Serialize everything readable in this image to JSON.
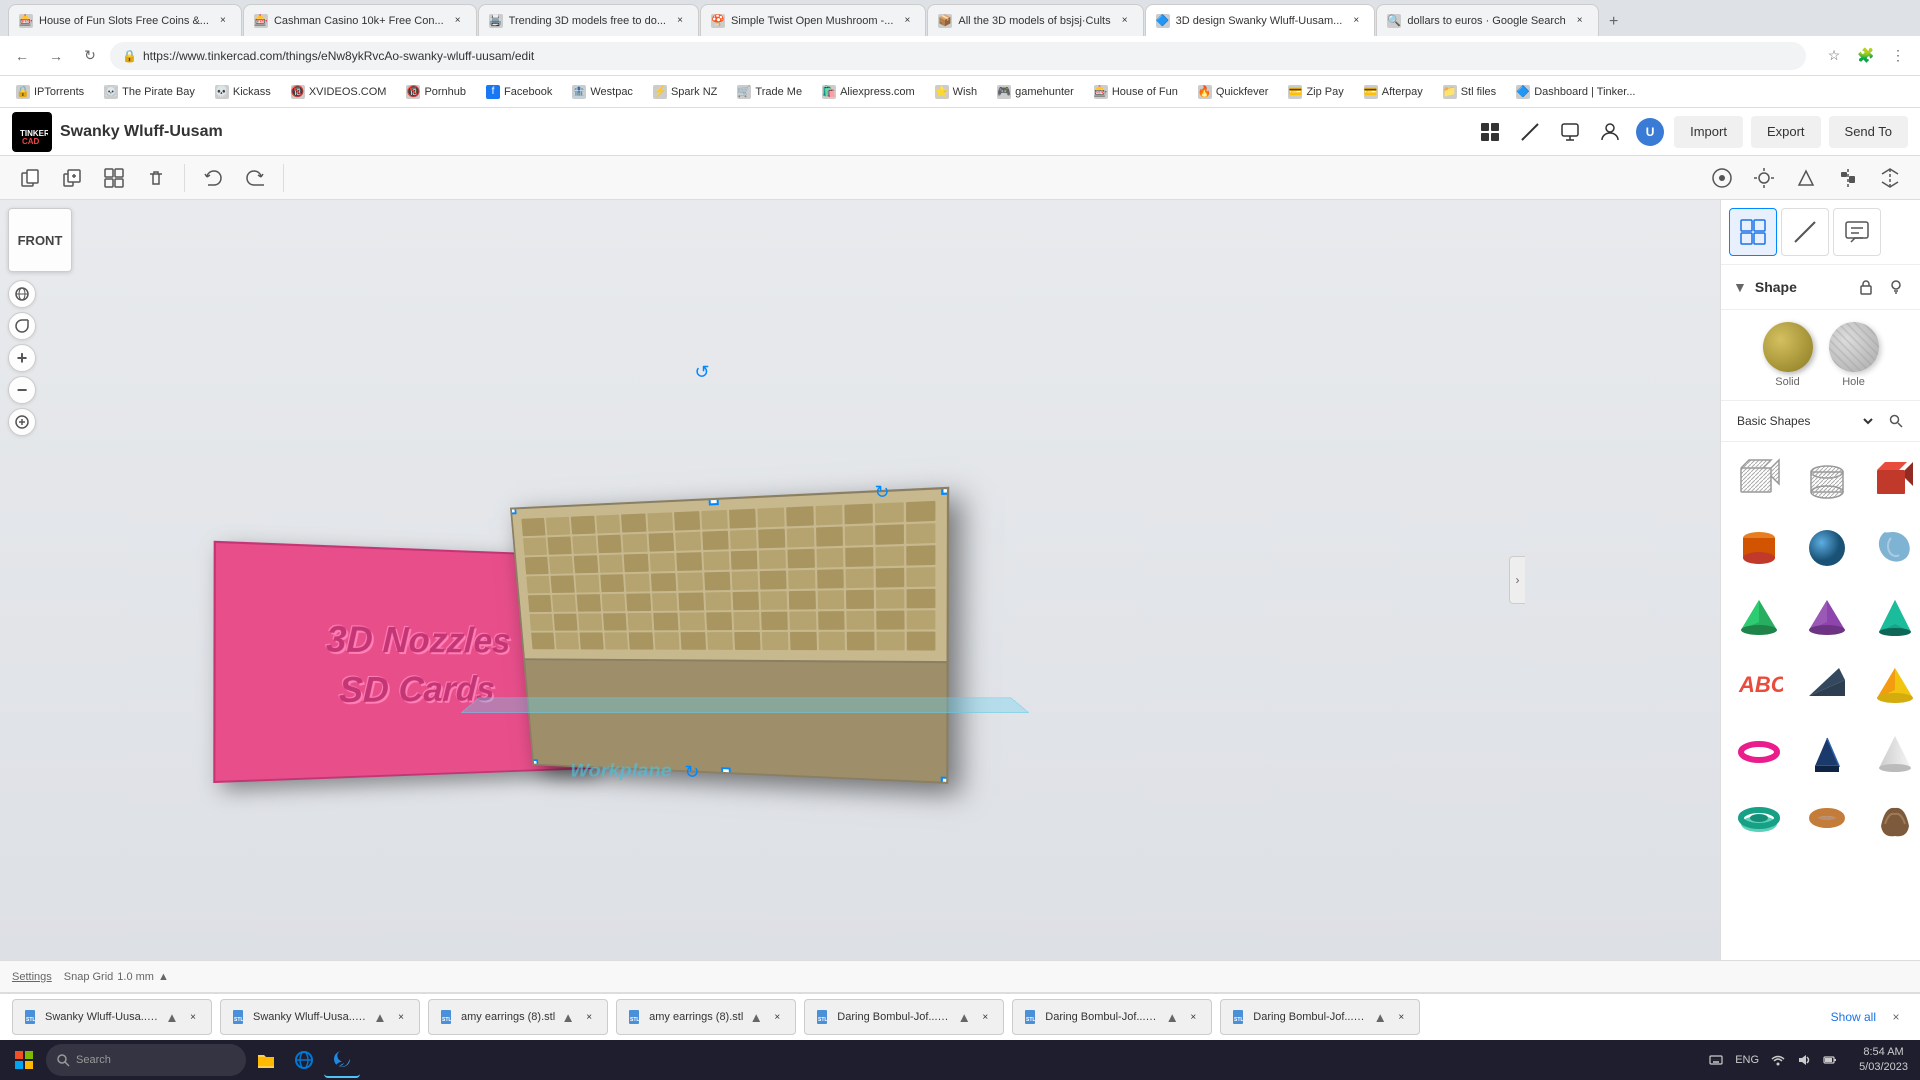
{
  "browser": {
    "tabs": [
      {
        "id": "tab1",
        "title": "House of Fun Slots Free Coins &...",
        "favicon": "🎰",
        "active": false
      },
      {
        "id": "tab2",
        "title": "Cashman Casino 10k+ Free Con...",
        "favicon": "🎰",
        "active": false
      },
      {
        "id": "tab3",
        "title": "Trending 3D models free to do...",
        "favicon": "🖨️",
        "active": false
      },
      {
        "id": "tab4",
        "title": "Simple Twist Open Mushroom -...",
        "favicon": "🍄",
        "active": false
      },
      {
        "id": "tab5",
        "title": "All the 3D models of bsjsj·Cults",
        "favicon": "📦",
        "active": false
      },
      {
        "id": "tab6",
        "title": "3D design Swanky Wluff-Uusam...",
        "favicon": "🔷",
        "active": true
      },
      {
        "id": "tab7",
        "title": "dollars to euros · Google Search",
        "favicon": "🔍",
        "active": false
      }
    ],
    "url": "https://www.tinkercad.com/things/eNw8ykRvcAo-swanky-wluff-uusam/edit",
    "bookmarks": [
      {
        "label": "IPTorrents",
        "favicon": "🔒"
      },
      {
        "label": "The Pirate Bay",
        "favicon": "☠️"
      },
      {
        "label": "Kickass",
        "favicon": "💀"
      },
      {
        "label": "XVIDEOS.COM",
        "favicon": "🔞"
      },
      {
        "label": "Pornhub",
        "favicon": "🔞"
      },
      {
        "label": "Facebook",
        "favicon": "📘"
      },
      {
        "label": "Westpac",
        "favicon": "🏦"
      },
      {
        "label": "Spark NZ",
        "favicon": "⚡"
      },
      {
        "label": "Trade Me",
        "favicon": "🛒"
      },
      {
        "label": "Aliexpress.com",
        "favicon": "🛍️"
      },
      {
        "label": "Wish",
        "favicon": "⭐"
      },
      {
        "label": "gamehunter",
        "favicon": "🎮"
      },
      {
        "label": "House of Fun",
        "favicon": "🎰"
      },
      {
        "label": "Quickfever",
        "favicon": "🔥"
      },
      {
        "label": "Zip Pay",
        "favicon": "💳"
      },
      {
        "label": "Afterpay",
        "favicon": "💳"
      },
      {
        "label": "Stl files",
        "favicon": "📁"
      },
      {
        "label": "Dashboard | Tinker...",
        "favicon": "🔷"
      }
    ]
  },
  "app": {
    "title": "Swanky Wluff-Uusam",
    "logo_text": "TINKERCAD",
    "header_buttons": {
      "import": "Import",
      "export": "Export",
      "send_to": "Send To"
    }
  },
  "toolbar": {
    "tools": [
      "copy",
      "duplicate",
      "group",
      "delete",
      "undo",
      "redo"
    ]
  },
  "view_panel": {
    "cube_label": "FRONT",
    "controls": [
      "+",
      "−",
      "⟳"
    ]
  },
  "workplane": {
    "label": "Workplane"
  },
  "scene": {
    "pink_text_line1": "3D Nozzles",
    "pink_text_line2": "SD Cards"
  },
  "shape_panel": {
    "title": "Shape",
    "solid_label": "Solid",
    "hole_label": "Hole",
    "lock_icon": "🔒",
    "bulb_icon": "💡"
  },
  "shapes_library": {
    "category": "Basic Shapes",
    "shapes": [
      {
        "name": "box-striped",
        "label": "Box Striped"
      },
      {
        "name": "cylinder-striped",
        "label": "Cylinder Striped"
      },
      {
        "name": "box-red",
        "label": "Box Red"
      },
      {
        "name": "cylinder-orange",
        "label": "Cylinder Orange"
      },
      {
        "name": "sphere-teal",
        "label": "Sphere Teal"
      },
      {
        "name": "shape-blue-organic",
        "label": "Organic Blue"
      },
      {
        "name": "pyramid-green",
        "label": "Pyramid Green"
      },
      {
        "name": "pyramid-purple",
        "label": "Pyramid Purple"
      },
      {
        "name": "cone-teal",
        "label": "Cone Teal"
      },
      {
        "name": "text-red",
        "label": "Text Red"
      },
      {
        "name": "wedge-blue",
        "label": "Wedge Blue"
      },
      {
        "name": "pyramid-yellow",
        "label": "Pyramid Yellow"
      },
      {
        "name": "torus-magenta",
        "label": "Torus Magenta"
      },
      {
        "name": "prism-blue",
        "label": "Prism Blue"
      },
      {
        "name": "cone-white",
        "label": "Cone White"
      },
      {
        "name": "torus-flat-teal",
        "label": "Torus Flat Teal"
      },
      {
        "name": "torus-brown",
        "label": "Torus Brown"
      },
      {
        "name": "shape-brown",
        "label": "Shape Brown"
      }
    ]
  },
  "bottom_bar": {
    "settings_label": "Settings",
    "snap_grid_label": "Snap Grid",
    "snap_grid_value": "1.0 mm",
    "expand_icon": "▲"
  },
  "download_bar": {
    "items": [
      {
        "name": "Swanky Wluff-Uusa....stl",
        "icon": "stl"
      },
      {
        "name": "Swanky Wluff-Uusa....stl",
        "icon": "stl"
      },
      {
        "name": "amy earrings (8).stl",
        "icon": "stl"
      },
      {
        "name": "amy earrings (8).stl",
        "icon": "stl"
      },
      {
        "name": "Daring Bombul-Jof....stl",
        "icon": "stl"
      },
      {
        "name": "Daring Bombul-Jof....stl",
        "icon": "stl"
      },
      {
        "name": "Daring Bombul-Jof....stl",
        "icon": "stl"
      }
    ],
    "show_all": "Show all"
  },
  "taskbar": {
    "time": "8:54 AM",
    "date": "5/03/2023",
    "language": "ENG",
    "tray_icons": [
      "network",
      "volume",
      "battery"
    ]
  }
}
